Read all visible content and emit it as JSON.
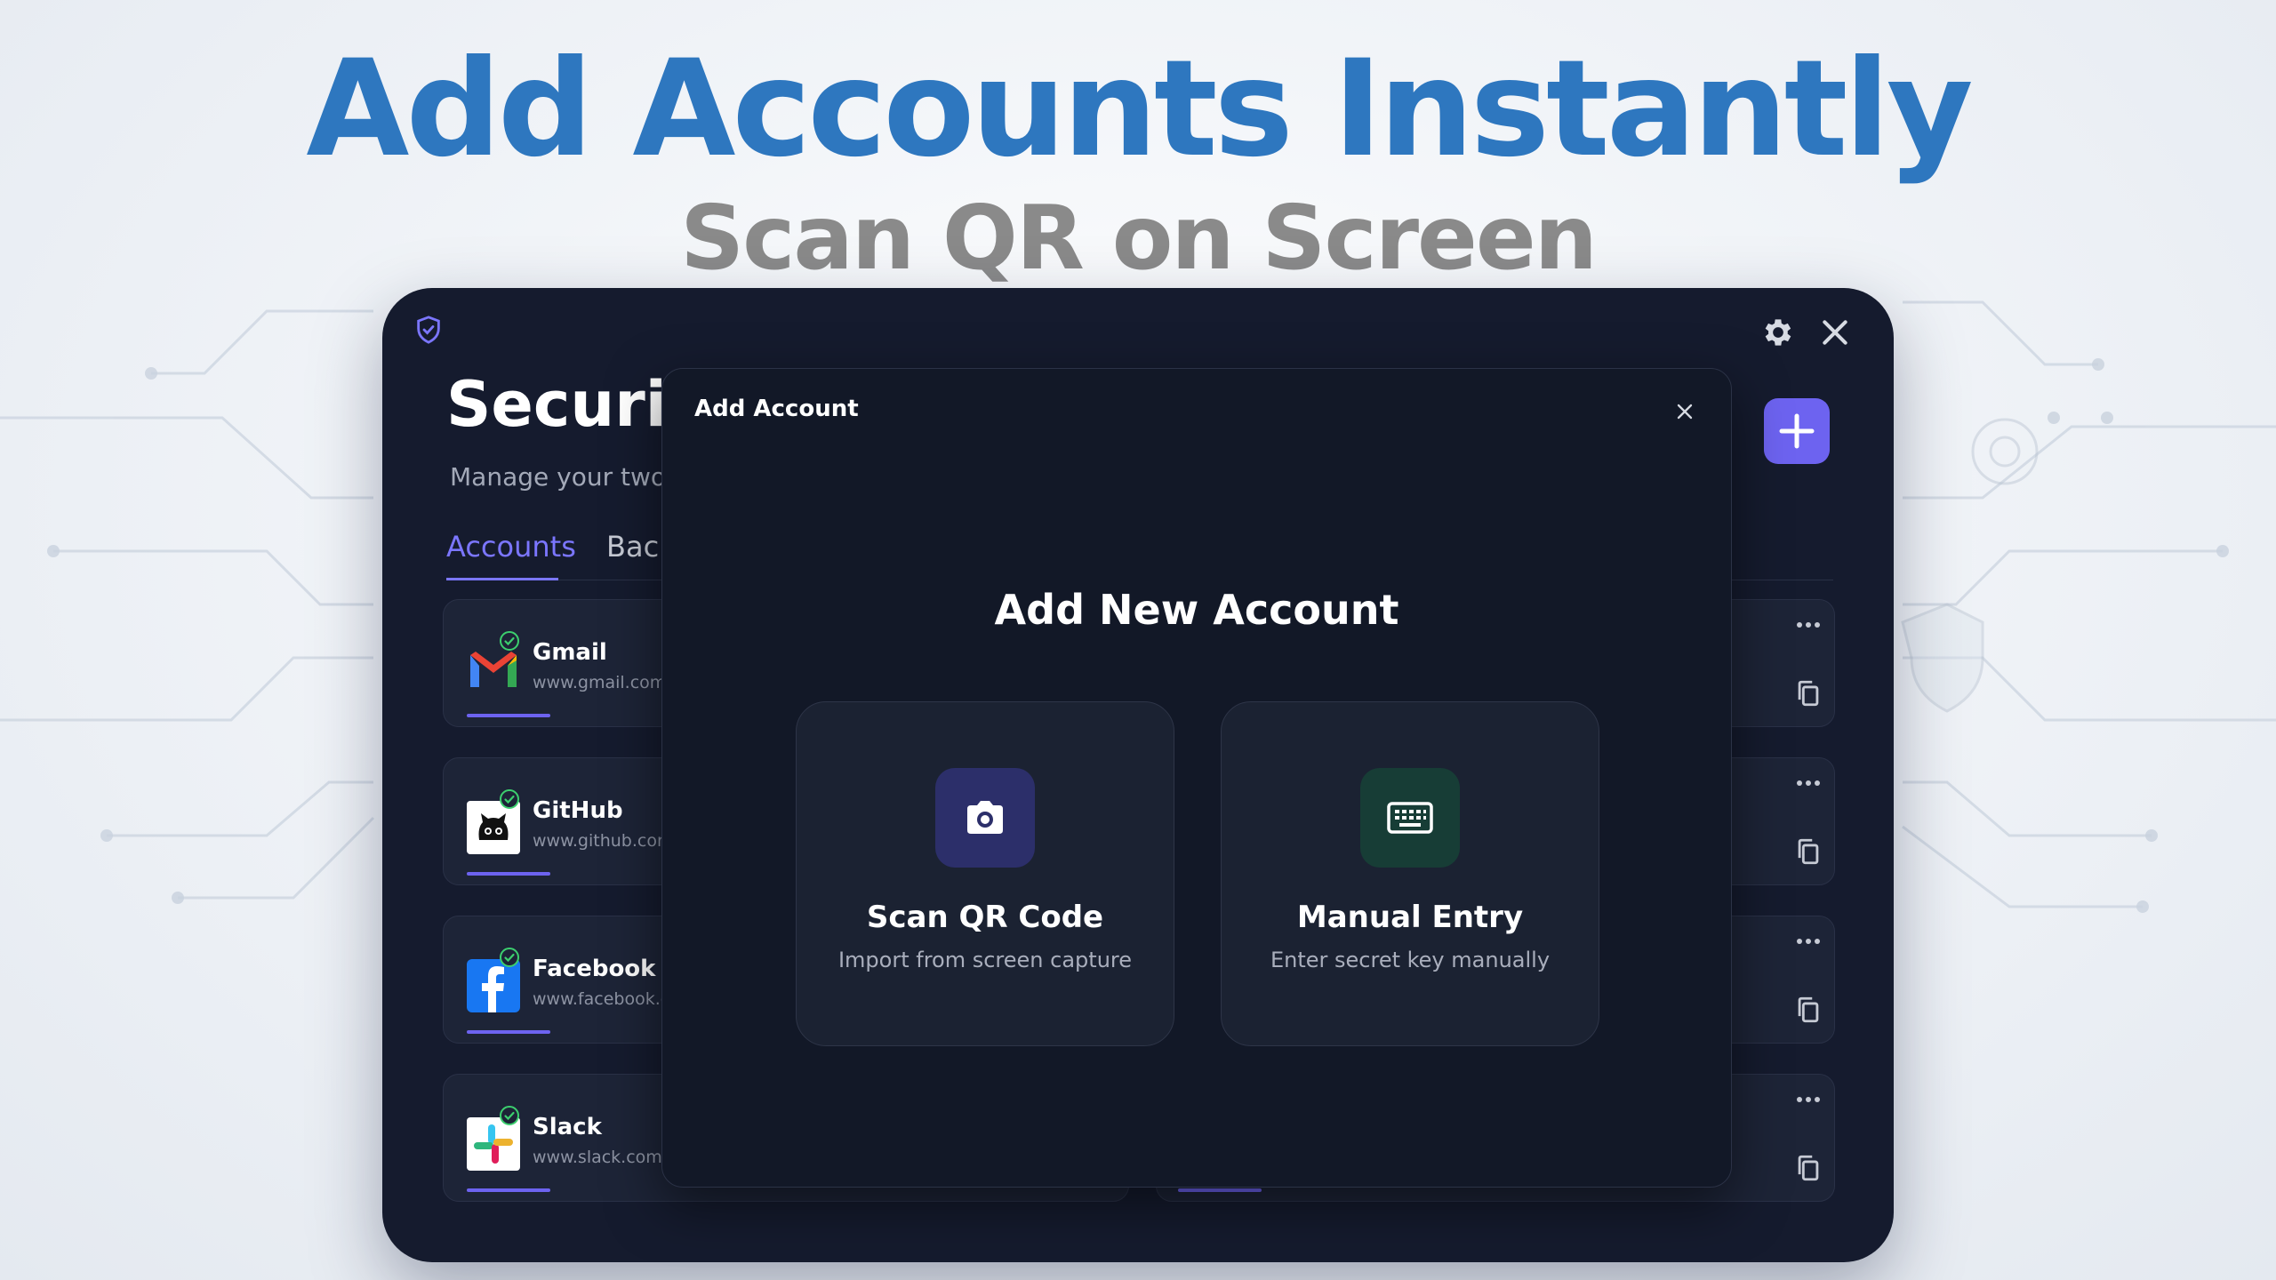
{
  "hero": {
    "title": "Add Accounts Instantly",
    "subtitle": "Scan QR on Screen"
  },
  "app": {
    "page_title": "Security",
    "page_subtitle": "Manage your two-",
    "tabs": [
      {
        "label": "Accounts",
        "active": true
      },
      {
        "label": "Back",
        "active": false
      }
    ],
    "accounts": [
      {
        "name": "Gmail",
        "url": "www.gmail.com",
        "logo": "gmail-icon"
      },
      {
        "name": "GitHub",
        "url": "www.github.com",
        "logo": "github-icon"
      },
      {
        "name": "Facebook",
        "url": "www.facebook.c",
        "logo": "facebook-icon"
      },
      {
        "name": "Slack",
        "url": "www.slack.com",
        "logo": "slack-icon"
      }
    ]
  },
  "modal": {
    "title": "Add Account",
    "heading": "Add New Account",
    "options": [
      {
        "label": "Scan QR Code",
        "desc": "Import from screen capture",
        "icon": "camera-icon"
      },
      {
        "label": "Manual Entry",
        "desc": "Enter secret key manually",
        "icon": "keyboard-icon"
      }
    ]
  },
  "colors": {
    "accent": "#6d63f0",
    "hero_title": "#2e77bf",
    "hero_subtitle": "#8a8a8a",
    "window_bg": "#151b2e",
    "qr_icon_bg": "#2c2f6a",
    "manual_icon_bg": "#173d36",
    "check": "#3ccf6e"
  }
}
